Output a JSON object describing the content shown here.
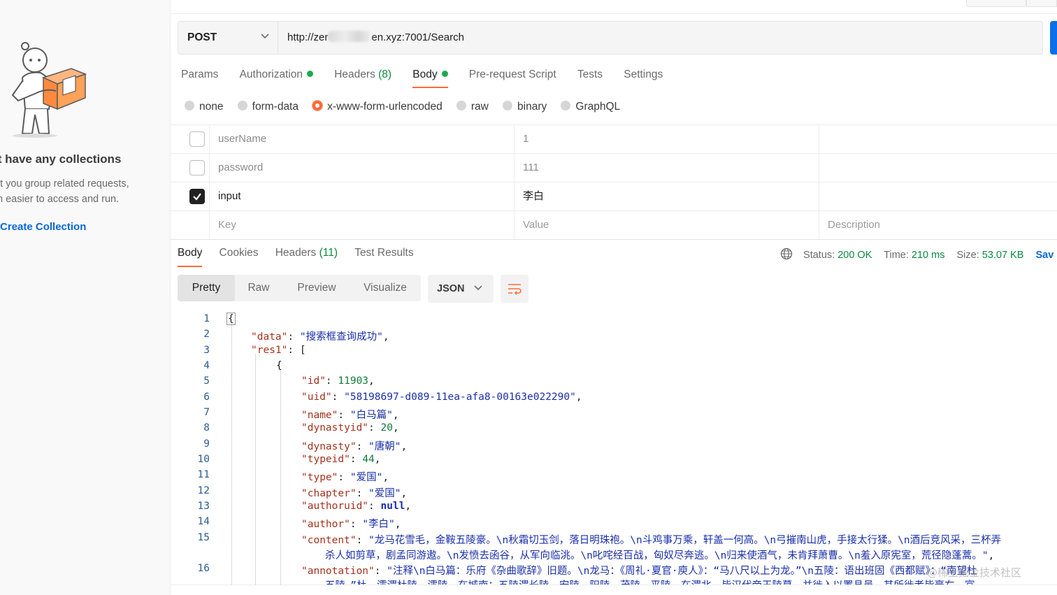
{
  "sidebar": {
    "empty_title": "’t have any collections",
    "empty_desc_line1": "et you group related requests,",
    "empty_desc_line2": "m easier to access and run.",
    "create_link": "Create Collection"
  },
  "request": {
    "method": "POST",
    "url_prefix": "http://zer",
    "url_suffix": "en.xyz:7001/Search",
    "tabs": [
      {
        "label": "Params"
      },
      {
        "label": "Authorization",
        "dot": true
      },
      {
        "label": "Headers",
        "count": "(8)"
      },
      {
        "label": "Body",
        "dot": true,
        "active": true
      },
      {
        "label": "Pre-request Script"
      },
      {
        "label": "Tests"
      },
      {
        "label": "Settings"
      }
    ],
    "body_types": [
      {
        "label": "none"
      },
      {
        "label": "form-data"
      },
      {
        "label": "x-www-form-urlencoded",
        "selected": true
      },
      {
        "label": "raw"
      },
      {
        "label": "binary"
      },
      {
        "label": "GraphQL"
      }
    ],
    "params": [
      {
        "checked": false,
        "key": "userName",
        "value": "1"
      },
      {
        "checked": false,
        "key": "password",
        "value": "111"
      },
      {
        "checked": true,
        "key": "input",
        "value": "李白"
      }
    ],
    "placeholders": {
      "key": "Key",
      "value": "Value",
      "description": "Description"
    }
  },
  "response": {
    "tabs": [
      {
        "label": "Body",
        "active": true
      },
      {
        "label": "Cookies"
      },
      {
        "label": "Headers",
        "count": "(11)"
      },
      {
        "label": "Test Results"
      }
    ],
    "status_label": "Status:",
    "status_value": "200 OK",
    "time_label": "Time:",
    "time_value": "210 ms",
    "size_label": "Size:",
    "size_value": "53.07 KB",
    "save_label": "Sav",
    "view_tabs": [
      "Pretty",
      "Raw",
      "Preview",
      "Visualize"
    ],
    "format": "JSON",
    "line_numbers": [
      "1",
      "2",
      "3",
      "4",
      "5",
      "6",
      "7",
      "8",
      "9",
      "10",
      "11",
      "12",
      "13",
      "14",
      "15",
      "16"
    ],
    "code_lines": [
      "{",
      "\"data\": \"搜索框查询成功\",",
      "\"res1\": [",
      "{",
      "\"id\": 11903,",
      "\"uid\": \"58198697-d089-11ea-afa8-00163e022290\",",
      "\"name\": \"白马篇\",",
      "\"dynastyid\": 20,",
      "\"dynasty\": \"唐朝\",",
      "\"typeid\": 44,",
      "\"type\": \"爱国\",",
      "\"chapter\": \"爱国\",",
      "\"authoruid\": null,",
      "\"author\": \"李白\",",
      "\"content\": \"龙马花雪毛，金鞍五陵豪。\\n秋霜切玉剑，落日明珠袍。\\n斗鸡事万乘，轩盖一何高。\\n弓摧南山虎，手接太行猱。\\n酒后竞风采，三杯弄",
      "杀人如剪草，剧孟同游遨。\\n发愤去函谷，从军向临洮。\\n叱咤经百战，匈奴尽奔逃。\\n归来使酒气，未肯拜萧曹。\\n羞入原宪室，荒径隐蓬蒿。\",",
      "\"annotation\": \"注释\\n白马篇：乐府《杂曲歌辞》旧题。\\n龙马：《周礼·夏官·庾人》：“马八尺以上为龙。”\\n五陵：语出班固《西都赋》：“南望杜",
      "五陵。”杜，濡渭杜陵，濡陵，在城南；五陵渭长陵，安陵，阳陵，茂陵，平陵，在渭北。皆汉代帝王陵墓，并徙入以置县邑，其所徙者皆豪右，富"
    ],
    "watermark": "@稀土掘金技术社区"
  },
  "icons": {
    "method_chevron": "chevron-down-icon",
    "format_chevron": "chevron-down-icon",
    "wrap": "wrap-lines-icon",
    "globe": "globe-icon",
    "check": "check-icon"
  }
}
